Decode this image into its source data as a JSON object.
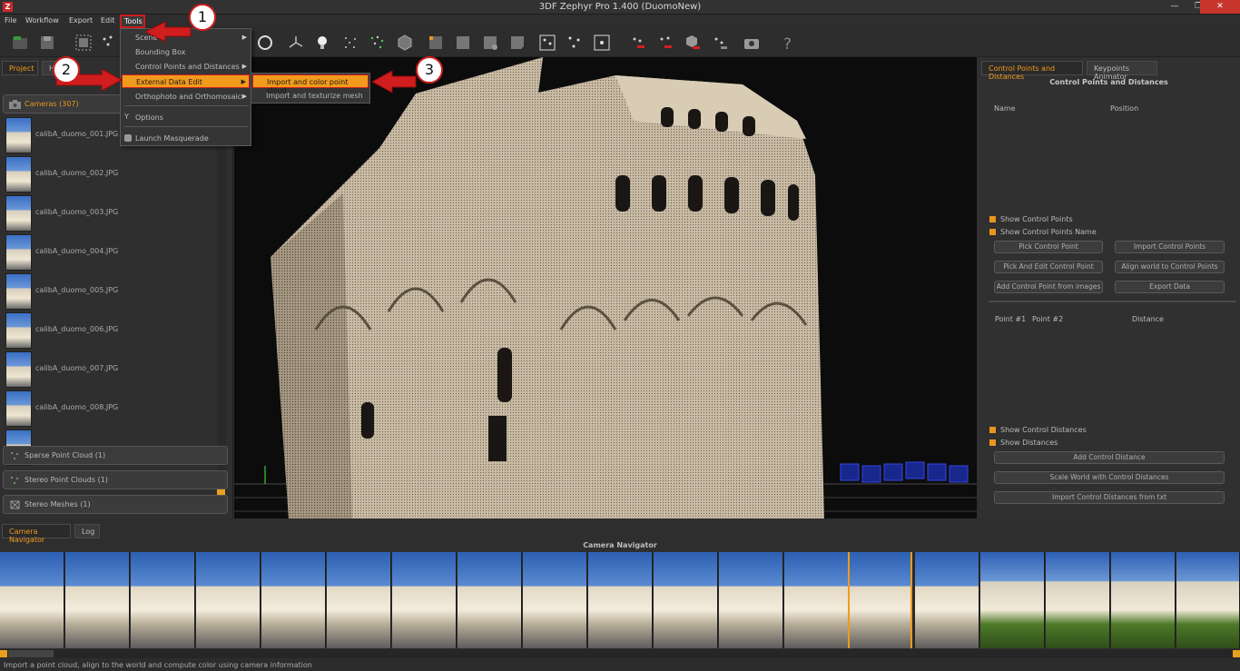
{
  "window": {
    "title": "3DF Zephyr Pro 1.400 (DuomoNew)",
    "app_icon": "Z",
    "minimize": "—",
    "restore": "❐",
    "close": "✕"
  },
  "menubar": {
    "file": "File",
    "workflow": "Workflow",
    "export": "Export",
    "edit": "Edit",
    "tools": "Tools"
  },
  "tools_menu": {
    "items": [
      {
        "label": "Scene",
        "has_submenu": true
      },
      {
        "label": "Bounding Box",
        "has_submenu": false
      },
      {
        "label": "Control Points and Distances",
        "has_submenu": true
      },
      {
        "label": "External Data Edit",
        "has_submenu": true
      },
      {
        "label": "Orthophoto and Orthomosaic",
        "has_submenu": true
      },
      {
        "label": "Options",
        "has_submenu": false
      },
      {
        "label": "Launch Masquerade",
        "has_submenu": false
      }
    ],
    "submenu": [
      {
        "label": "Import and color point cloud"
      },
      {
        "label": "Import and texturize mesh"
      }
    ]
  },
  "annotations": [
    "1",
    "2",
    "3"
  ],
  "left_panel": {
    "tabs": [
      "Project",
      "H"
    ],
    "cameras_label": "Cameras (307)",
    "cameras": [
      "calibA_duomo_001.JPG",
      "calibA_duomo_002.JPG",
      "calibA_duomo_003.JPG",
      "calibA_duomo_004.JPG",
      "calibA_duomo_005.JPG",
      "calibA_duomo_006.JPG",
      "calibA_duomo_007.JPG",
      "calibA_duomo_008.JPG"
    ],
    "sparse": "Sparse Point Cloud (1)",
    "stereo_clouds": "Stereo Point Clouds (1)",
    "stereo_meshes": "Stereo Meshes (1)"
  },
  "right_panel": {
    "tabs": [
      "Control Points and Distances",
      "Keypoints Animator"
    ],
    "title": "Control Points and Distances",
    "col_name": "Name",
    "col_position": "Position",
    "show_cp": "Show Control Points",
    "show_cp_name": "Show Control Points Name",
    "btn_pick": "Pick Control Point",
    "btn_import_cp": "Import Control Points",
    "btn_pick_edit": "Pick And Edit Control Point",
    "btn_align": "Align world to Control Points",
    "btn_add_from_images": "Add Control Point from images",
    "btn_export": "Export Data",
    "col_point1": "Point #1",
    "col_point2": "Point #2",
    "col_distance": "Distance",
    "show_cd": "Show Control Distances",
    "show_dist": "Show Distances",
    "btn_add_dist": "Add Control Distance",
    "btn_scale": "Scale World with Control Distances",
    "btn_import_dist": "Import Control Distances from txt"
  },
  "bottom": {
    "tabs": [
      "Camera Navigator",
      "Log"
    ],
    "title": "Camera Navigator"
  },
  "status": "Import a point cloud, align to the world and compute color using camera information",
  "colors": {
    "accent": "#f29a1c",
    "annotation_red": "#d01d1d"
  }
}
